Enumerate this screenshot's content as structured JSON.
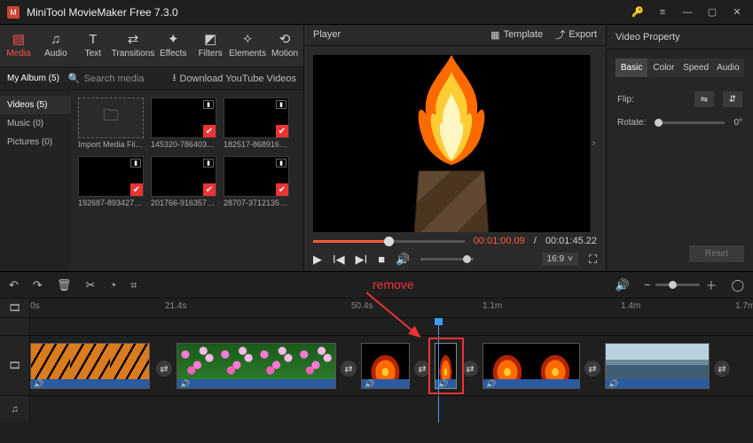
{
  "window": {
    "title": "MiniTool MovieMaker Free 7.3.0"
  },
  "toolTabs": [
    {
      "label": "Media",
      "icon": "▤"
    },
    {
      "label": "Audio",
      "icon": "♫"
    },
    {
      "label": "Text",
      "icon": "T"
    },
    {
      "label": "Transitions",
      "icon": "⇄"
    },
    {
      "label": "Effects",
      "icon": "✦"
    },
    {
      "label": "Filters",
      "icon": "◩"
    },
    {
      "label": "Elements",
      "icon": "✧"
    },
    {
      "label": "Motion",
      "icon": "⟲"
    }
  ],
  "subbar": {
    "album": "My Album (5)",
    "searchPlaceholder": "Search media",
    "download": "Download YouTube Videos"
  },
  "cats": [
    {
      "label": "Videos (5)"
    },
    {
      "label": "Music (0)"
    },
    {
      "label": "Pictures (0)"
    }
  ],
  "thumbs": {
    "import": "Import Media Files",
    "t1": "145320-786403437...",
    "t2": "182517-868916307...",
    "t3": "192687-893427276...",
    "t4": "201766-916357972...",
    "t5": "28707-371213524_t..."
  },
  "player": {
    "title": "Player",
    "template": "Template",
    "export": "Export",
    "cur": "00:01:00.09",
    "sep": " / ",
    "dur": "00:01:45.22",
    "aspect": "16:9"
  },
  "rp": {
    "title": "Video Property",
    "tabs": {
      "basic": "Basic",
      "color": "Color",
      "speed": "Speed",
      "audio": "Audio"
    },
    "flip": "Flip:",
    "rotate": "Rotate:",
    "rotateVal": "0°",
    "reset": "Reset"
  },
  "ruler": {
    "t0": "0s",
    "t1": "21.4s",
    "t2": "50.4s",
    "t3": "1.1m",
    "t4": "1.4m",
    "t5": "1.7m"
  },
  "annot": {
    "remove": "remove"
  }
}
